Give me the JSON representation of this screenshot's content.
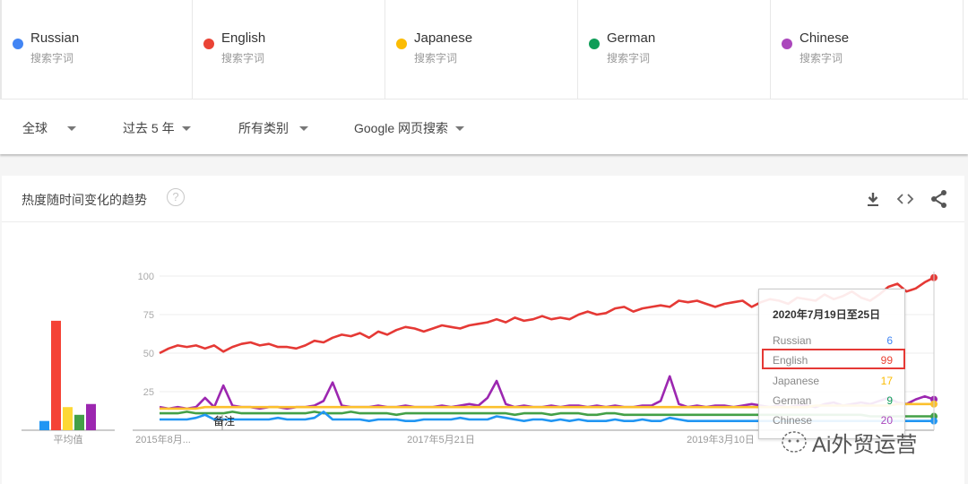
{
  "terms": [
    {
      "name": "Russian",
      "sub": "搜索字词",
      "color": "#4285f4"
    },
    {
      "name": "English",
      "sub": "搜索字词",
      "color": "#ea4335"
    },
    {
      "name": "Japanese",
      "sub": "搜索字词",
      "color": "#fbbc04"
    },
    {
      "name": "German",
      "sub": "搜索字词",
      "color": "#0f9d58"
    },
    {
      "name": "Chinese",
      "sub": "搜索字词",
      "color": "#ab47bc"
    }
  ],
  "filters": [
    {
      "label": "全球"
    },
    {
      "label": "过去 5 年"
    },
    {
      "label": "所有类别"
    },
    {
      "label": "Google 网页搜索"
    }
  ],
  "card": {
    "title": "热度随时间变化的趋势",
    "help_icon": "question-circle-icon",
    "actions": [
      "download-icon",
      "embed-code-icon",
      "share-icon"
    ]
  },
  "chart_data": {
    "type": "line",
    "title": "热度随时间变化的趋势",
    "ylim": [
      0,
      100
    ],
    "yticks": [
      "100",
      "75",
      "50",
      "25"
    ],
    "xticks": [
      "2015年8月...",
      "2017年5月21日",
      "2019年3月10日"
    ],
    "annotation": "备注",
    "grid": true,
    "average_bar": {
      "label": "平均值",
      "values": {
        "Russian": 6,
        "English": 71,
        "Japanese": 15,
        "German": 10,
        "Chinese": 17
      }
    },
    "series": [
      {
        "name": "English",
        "color": "#e53935",
        "values": [
          50,
          53,
          55,
          54,
          55,
          53,
          55,
          51,
          54,
          56,
          57,
          55,
          56,
          54,
          54,
          53,
          55,
          58,
          57,
          60,
          62,
          61,
          63,
          60,
          64,
          62,
          65,
          67,
          66,
          64,
          66,
          68,
          67,
          66,
          68,
          69,
          70,
          72,
          70,
          73,
          71,
          72,
          74,
          72,
          73,
          72,
          75,
          77,
          75,
          76,
          79,
          80,
          77,
          79,
          80,
          81,
          80,
          84,
          83,
          84,
          82,
          80,
          82,
          83,
          84,
          80,
          83,
          85,
          84,
          82,
          86,
          85,
          84,
          88,
          85,
          87,
          90,
          86,
          84,
          88,
          93,
          95,
          90,
          92,
          96,
          99
        ]
      },
      {
        "name": "Chinese",
        "color": "#9c27b0",
        "values": [
          15,
          14,
          15,
          14,
          15,
          21,
          15,
          29,
          16,
          15,
          15,
          14,
          15,
          15,
          14,
          15,
          15,
          16,
          19,
          31,
          16,
          15,
          15,
          15,
          16,
          15,
          15,
          16,
          15,
          15,
          15,
          16,
          15,
          16,
          17,
          16,
          21,
          32,
          17,
          15,
          16,
          15,
          15,
          16,
          15,
          16,
          16,
          15,
          16,
          15,
          16,
          15,
          15,
          16,
          16,
          19,
          35,
          17,
          15,
          16,
          15,
          16,
          16,
          15,
          16,
          17,
          16,
          15,
          16,
          15,
          16,
          16,
          15,
          17,
          18,
          16,
          17,
          18,
          17,
          19,
          21,
          18,
          17,
          20,
          22,
          20
        ]
      },
      {
        "name": "Japanese",
        "color": "#fbc02d",
        "values": [
          14,
          14,
          14,
          14,
          14,
          15,
          15,
          15,
          15,
          15,
          15,
          15,
          15,
          15,
          15,
          15,
          15,
          15,
          15,
          15,
          15,
          15,
          15,
          15,
          15,
          15,
          15,
          15,
          15,
          15,
          15,
          15,
          15,
          15,
          15,
          15,
          15,
          15,
          15,
          15,
          15,
          15,
          15,
          15,
          15,
          15,
          15,
          15,
          15,
          15,
          15,
          15,
          15,
          15,
          15,
          15,
          15,
          15,
          15,
          15,
          15,
          15,
          15,
          15,
          15,
          15,
          15,
          15,
          15,
          15,
          15,
          15,
          16,
          16,
          16,
          16,
          16,
          16,
          16,
          16,
          16,
          17,
          17,
          17,
          17,
          17
        ]
      },
      {
        "name": "German",
        "color": "#43a047",
        "values": [
          11,
          11,
          11,
          12,
          11,
          11,
          11,
          11,
          12,
          11,
          11,
          11,
          11,
          11,
          11,
          11,
          11,
          12,
          11,
          11,
          11,
          12,
          11,
          11,
          11,
          11,
          10,
          11,
          11,
          11,
          11,
          11,
          11,
          11,
          11,
          11,
          11,
          11,
          11,
          10,
          11,
          11,
          11,
          10,
          11,
          11,
          11,
          10,
          10,
          11,
          11,
          10,
          10,
          10,
          10,
          10,
          10,
          10,
          10,
          10,
          10,
          10,
          10,
          10,
          10,
          10,
          10,
          10,
          10,
          10,
          10,
          10,
          10,
          10,
          10,
          10,
          10,
          10,
          9,
          9,
          9,
          9,
          9,
          9,
          9,
          9
        ]
      },
      {
        "name": "Russian",
        "color": "#2196f3",
        "values": [
          7,
          7,
          7,
          7,
          8,
          10,
          7,
          7,
          7,
          7,
          7,
          7,
          7,
          8,
          7,
          7,
          7,
          8,
          12,
          7,
          7,
          7,
          7,
          6,
          7,
          7,
          7,
          6,
          6,
          7,
          7,
          7,
          7,
          8,
          7,
          7,
          7,
          9,
          8,
          7,
          6,
          7,
          7,
          6,
          7,
          6,
          7,
          6,
          6,
          6,
          7,
          6,
          6,
          7,
          6,
          6,
          8,
          7,
          6,
          6,
          6,
          6,
          6,
          6,
          6,
          6,
          6,
          6,
          6,
          6,
          6,
          6,
          6,
          6,
          6,
          6,
          6,
          6,
          6,
          6,
          6,
          6,
          6,
          6,
          6,
          6
        ]
      }
    ],
    "tooltip": {
      "title": "2020年7月19日至25日",
      "rows": [
        {
          "name": "Russian",
          "value": "6",
          "color": "#4285f4"
        },
        {
          "name": "English",
          "value": "99",
          "color": "#ea4335"
        },
        {
          "name": "Japanese",
          "value": "17",
          "color": "#fbbc04"
        },
        {
          "name": "German",
          "value": "9",
          "color": "#0f9d58"
        },
        {
          "name": "Chinese",
          "value": "20",
          "color": "#ab47bc"
        }
      ],
      "highlighted": "English"
    }
  },
  "watermark": "Ai外贸运营"
}
